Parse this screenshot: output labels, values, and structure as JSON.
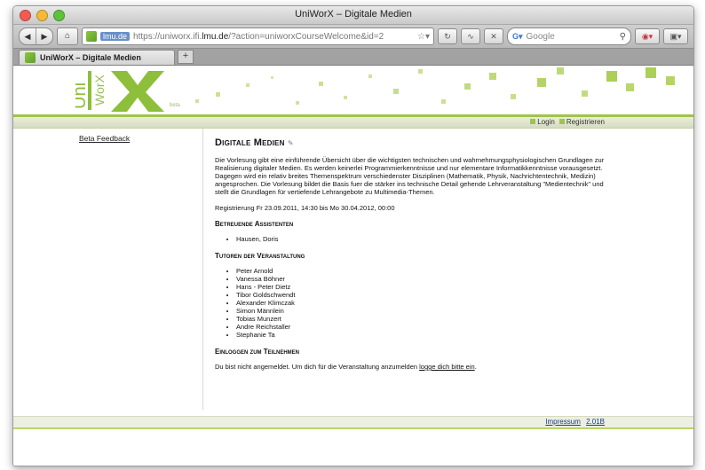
{
  "window": {
    "title": "UniWorX – Digitale Medien"
  },
  "toolbar": {
    "back_icon": "back-arrow-icon",
    "forward_icon": "forward-arrow-icon",
    "home_icon": "home-icon",
    "url_domain": "lmu.de",
    "url_prefix": "https://uniworx.ifi.",
    "url_host": "lmu.de",
    "url_path": "/?action=uniworxCourseWelcome&id=2",
    "search_placeholder": "Google"
  },
  "tab": {
    "title": "UniWorX – Digitale Medien",
    "add": "+"
  },
  "header": {
    "beta": "beta",
    "login": "Login",
    "register": "Registrieren",
    "accent": "#9fc44a"
  },
  "sidebar": {
    "feedback": "Beta Feedback"
  },
  "main": {
    "title": "Digitale Medien",
    "description": "Die Vorlesung gibt eine einführende Übersicht über die wichtigsten technischen und wahrnehmungsphysiologischen Grundlagen zur Realisierung digitaler Medien. Es werden keinerlei Programmierkenntnisse und nur elementare Informatikkenntnisse vorausgesetzt. Dagegen wird ein relativ breites Themenspektrum verschiedenster Disziplinen (Mathematik, Physik, Nachrichtentechnik, Medizin) angesprochen. Die Vorlesung bildet die Basis fuer die stärker ins technische Detail gehende Lehrveranstaltung \"Medientechnik\" und stellt die Grundlagen für vertiefende Lehrangebote zu Multimedia-Themen.",
    "registration": "Registrierung Fr 23.09.2011, 14:30 bis Mo 30.04.2012, 00:00",
    "assistants_heading": "Betreuende Assistenten",
    "assistants": [
      "Hausen, Doris"
    ],
    "tutors_heading": "Tutoren der Veranstaltung",
    "tutors": [
      "Peter Arnold",
      "Vanessa Böhner",
      "Hans - Peter Dietz",
      "Tibor Goldschwendt",
      "Alexander Klimczak",
      "Simon Männlein",
      "Tobias Munzert",
      "Andre Reichstaller",
      "Stephanie Ta"
    ],
    "login_heading": "Einloggen zum Teilnehmen",
    "login_text": "Du bist nicht angemeldet. Um dich für die Veranstaltung anzumelden ",
    "login_link": "logge dich bitte ein",
    "login_end": "."
  },
  "footer": {
    "impressum": "Impressum",
    "version": "2.01B"
  }
}
